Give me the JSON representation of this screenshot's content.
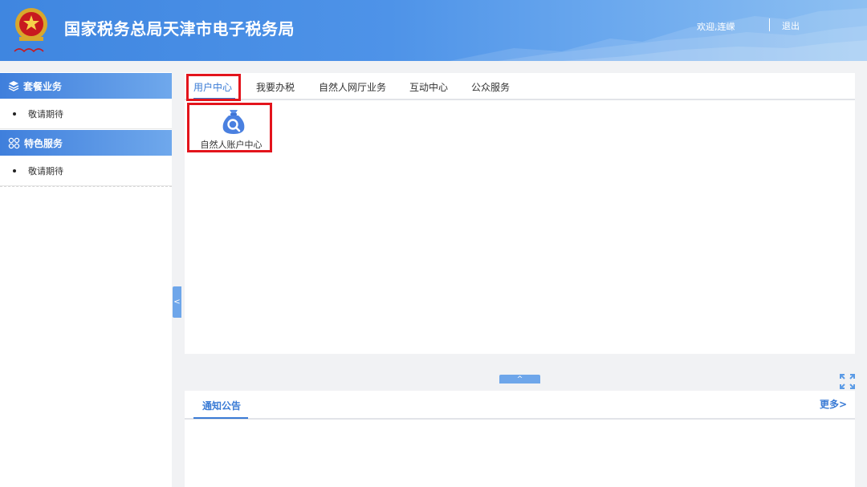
{
  "header": {
    "site_title": "国家税务总局天津市电子税务局",
    "welcome_text": "欢迎,连嵘",
    "logout_label": "退出",
    "logo_icon": "tax-emblem-icon"
  },
  "sidebar": {
    "sections": [
      {
        "title": "套餐业务",
        "icon": "layers-icon",
        "items": [
          "敬请期待"
        ]
      },
      {
        "title": "特色服务",
        "icon": "grid-icon",
        "items": [
          "敬请期待"
        ]
      }
    ],
    "collapse_glyph": "<"
  },
  "main": {
    "tabs": [
      {
        "label": "用户中心",
        "active": true
      },
      {
        "label": "我要办税"
      },
      {
        "label": "自然人网厅业务"
      },
      {
        "label": "互动中心"
      },
      {
        "label": "公众服务"
      }
    ],
    "apps": [
      {
        "label": "自然人账户中心",
        "icon": "money-bag-search-icon"
      }
    ],
    "expand_glyph": "^"
  },
  "notice": {
    "title": "通知公告",
    "more_label": "更多>"
  },
  "colors": {
    "accent": "#3a7bd5",
    "highlight_box": "#e3141c",
    "header_gradient_start": "#3f86e0",
    "header_gradient_end": "#8ec0f2"
  }
}
